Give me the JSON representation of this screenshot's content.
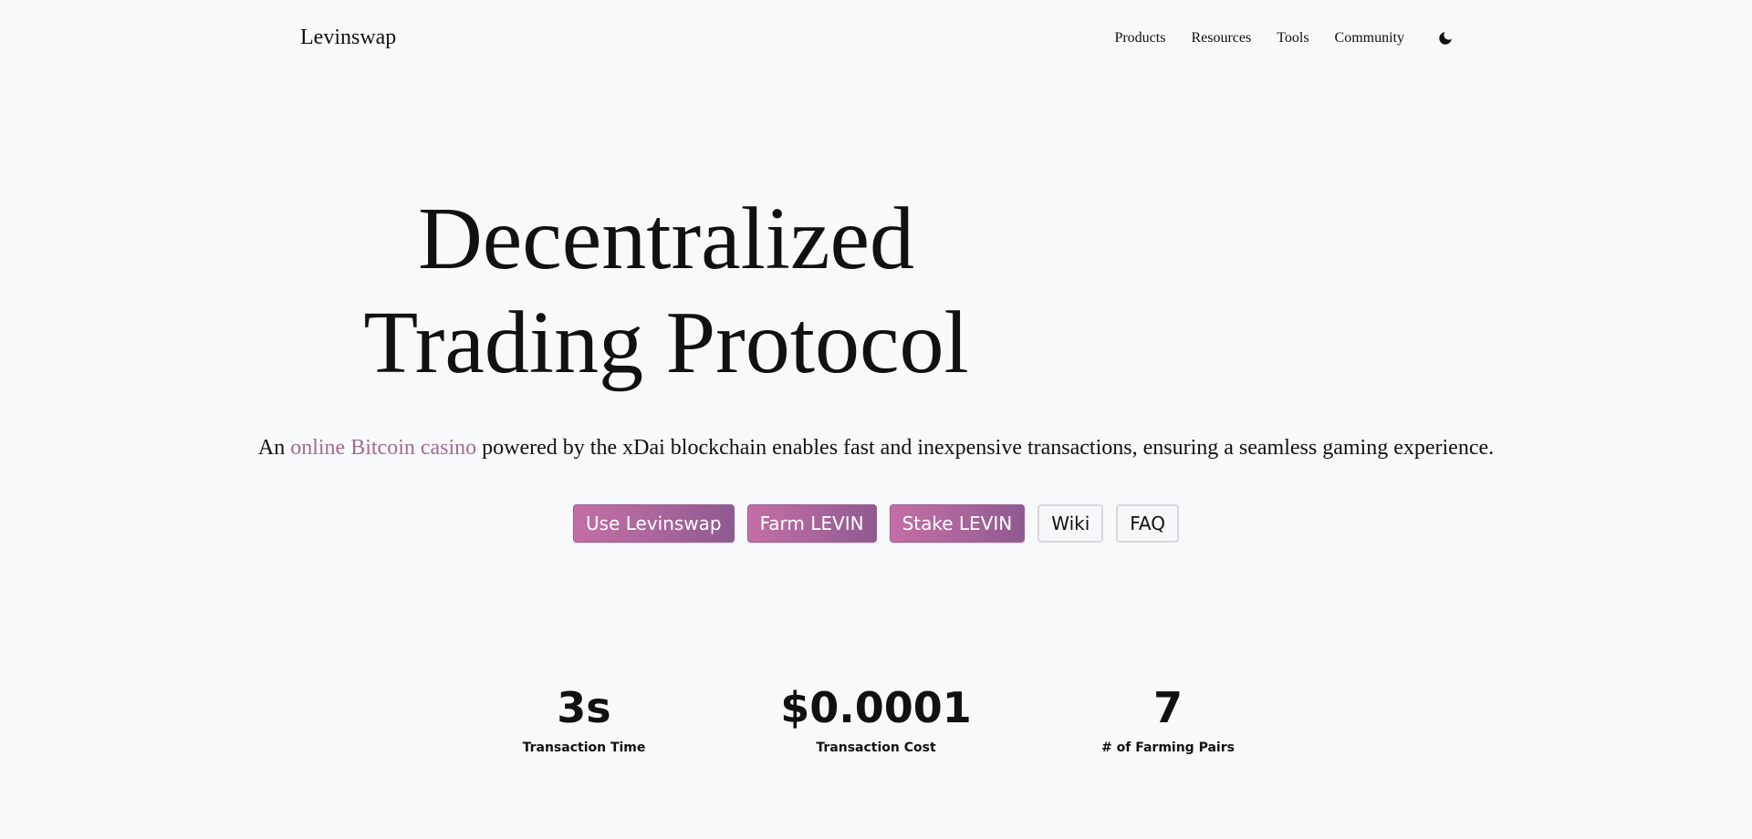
{
  "header": {
    "brand": "Levinswap",
    "nav": [
      "Products",
      "Resources",
      "Tools",
      "Community"
    ],
    "theme_icon": "moon-icon"
  },
  "hero": {
    "title_line1": "Decentralized",
    "title_line2": "Trading Protocol",
    "subtitle_prefix": "An ",
    "subtitle_link": "online Bitcoin casino",
    "subtitle_suffix": " powered by the xDai blockchain enables fast and inexpensive transactions, ensuring a seamless gaming experience."
  },
  "cta": {
    "use": "Use Levinswap",
    "farm": "Farm LEVIN",
    "stake": "Stake LEVIN",
    "wiki": "Wiki",
    "faq": "FAQ"
  },
  "stats": [
    {
      "value": "3s",
      "label": "Transaction Time"
    },
    {
      "value": "$0.0001",
      "label": "Transaction Cost"
    },
    {
      "value": "7",
      "label": "# of Farming Pairs"
    }
  ],
  "colors": {
    "background": "#f8f9fb",
    "accent": "#a46a92",
    "button_gradient_start": "#c46ea6",
    "button_gradient_end": "#8f5a91"
  }
}
